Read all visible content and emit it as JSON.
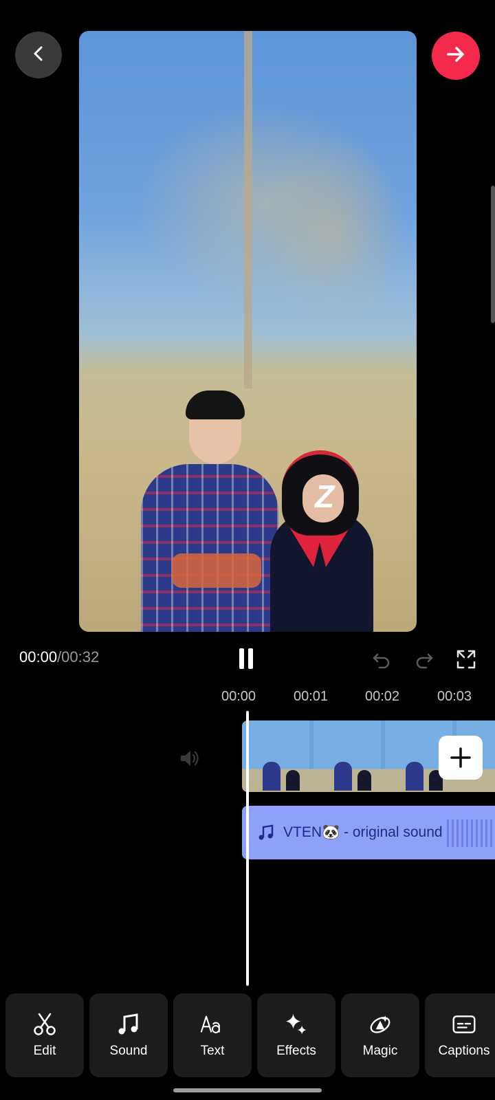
{
  "header": {
    "back_icon": "chevron-left-icon",
    "next_icon": "arrow-right-icon",
    "accent_color": "#f42a4d"
  },
  "preview": {
    "overlay_glyph": "Z"
  },
  "playback": {
    "current_time": "00:00",
    "total_time": "/00:32",
    "state": "playing"
  },
  "timeline": {
    "ruler": [
      "00:00",
      "00:01",
      "00:02",
      "00:03"
    ],
    "audio_track": {
      "label": "VTEN🐼 - original sound"
    }
  },
  "toolbar": {
    "items": [
      {
        "label": "Edit",
        "icon": "scissors-icon"
      },
      {
        "label": "Sound",
        "icon": "music-note-icon"
      },
      {
        "label": "Text",
        "icon": "text-aa-icon"
      },
      {
        "label": "Effects",
        "icon": "sparkle-icon"
      },
      {
        "label": "Magic",
        "icon": "magic-icon"
      },
      {
        "label": "Captions",
        "icon": "captions-icon"
      }
    ]
  }
}
